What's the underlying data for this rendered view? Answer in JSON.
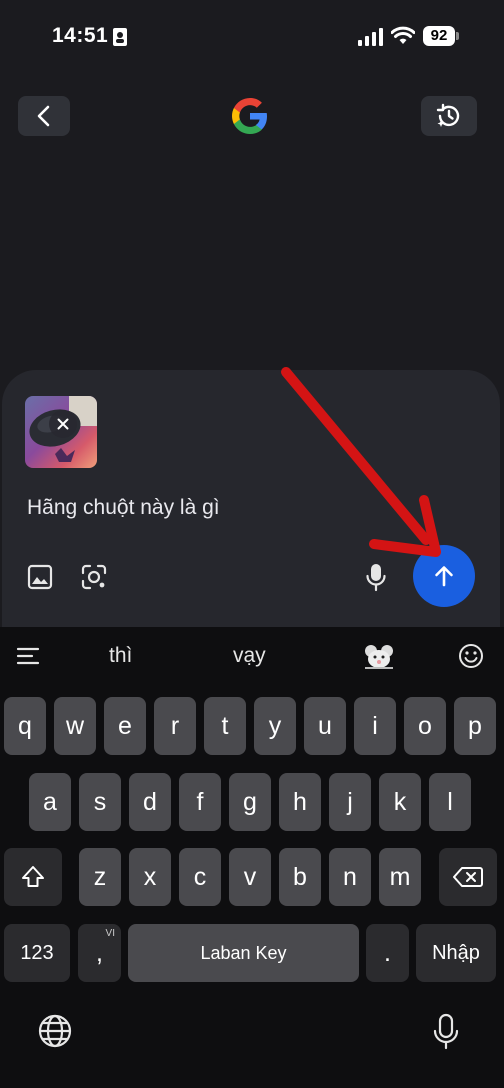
{
  "status": {
    "time": "14:51",
    "battery": "92"
  },
  "nav": {
    "back_icon": "chevron-left-icon",
    "history_icon": "history-icon",
    "logo": "google-logo"
  },
  "compose": {
    "query": "Hãng chuột này là gì",
    "tools": [
      "image-gallery-icon",
      "lens-icon",
      "microphone-icon"
    ],
    "send_icon": "arrow-up-icon"
  },
  "keyboard": {
    "suggestions": [
      "thì",
      "vạy"
    ],
    "row1": [
      "q",
      "w",
      "e",
      "r",
      "t",
      "y",
      "u",
      "i",
      "o",
      "p"
    ],
    "row2": [
      "a",
      "s",
      "d",
      "f",
      "g",
      "h",
      "j",
      "k",
      "l"
    ],
    "row3": [
      "z",
      "x",
      "c",
      "v",
      "b",
      "n",
      "m"
    ],
    "numbers_label": "123",
    "comma_label": ",",
    "lang_badge": "VI",
    "space_label": "Laban Key",
    "period_label": ".",
    "enter_label": "Nhập"
  },
  "colors": {
    "background": "#1b1b1f",
    "card": "#26272d",
    "send": "#1a5fe0",
    "annotation": "#d41414"
  }
}
